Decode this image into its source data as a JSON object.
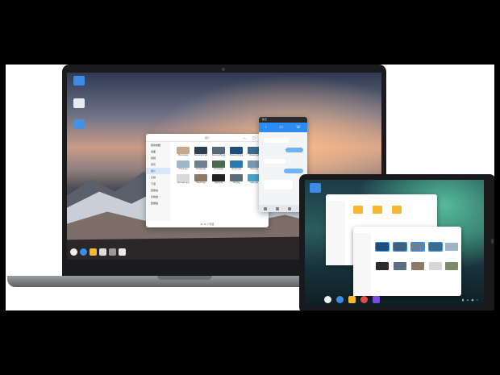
{
  "laptop": {
    "file_manager": {
      "title": "图片",
      "window_controls": "— ▢ ✕",
      "sidebar": [
        "我的电脑",
        "桌面",
        "视频",
        "音乐",
        "图片",
        "文档",
        "下载",
        "回收站",
        "系统盘",
        "数据盘"
      ],
      "files": [
        "Picture.jpg",
        "Scenery01.jpg",
        "Scenery02.jpg",
        "Scenery03.jpg",
        "Flower.jpg",
        "Photo.jpg",
        "Sunset.jpg",
        "Forest.jpg",
        "Ocean.jpg",
        "River.jpg",
        "Mountain.jpg",
        "Desert.jpg",
        "Night.jpg",
        "City.jpg",
        "Lake.jpg"
      ],
      "status": "共 15 个项目"
    },
    "chat": {
      "title": "聊天"
    }
  },
  "colors": {
    "accent": "#2d8cf0",
    "folder": "#f7b733"
  }
}
